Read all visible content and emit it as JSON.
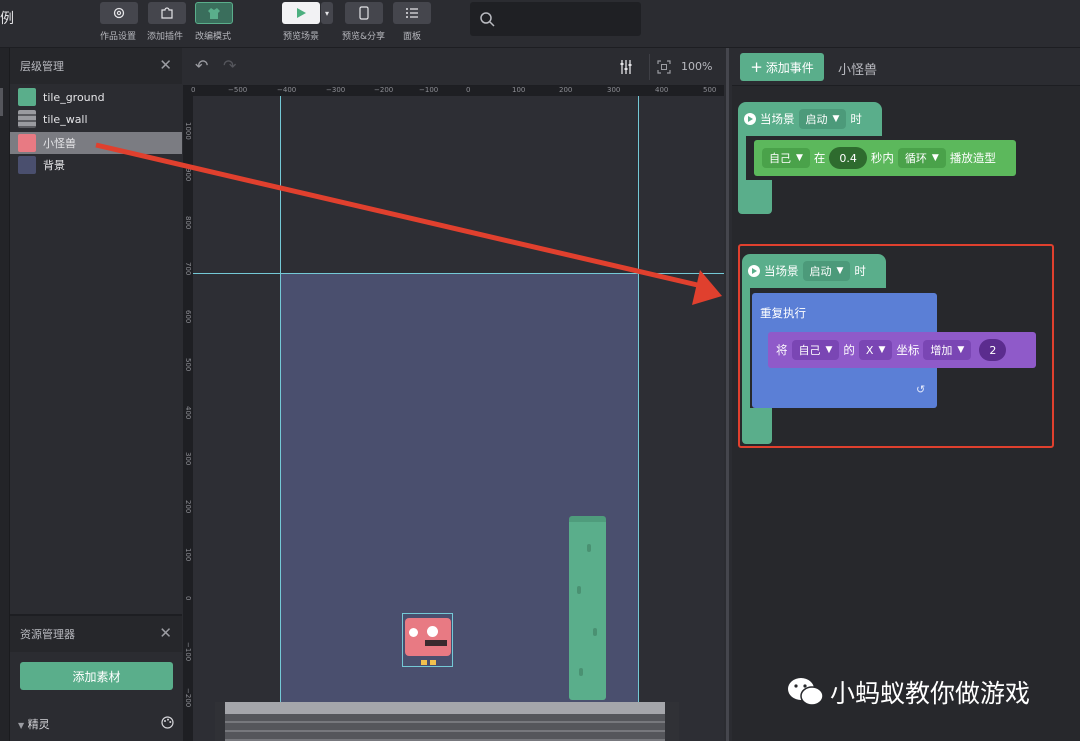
{
  "topbar": {
    "title_fragment": "例",
    "buttons": [
      {
        "label": "作品设置",
        "icon": "gear-icon"
      },
      {
        "label": "添加插件",
        "icon": "puzzle-icon"
      },
      {
        "label": "改编模式",
        "icon": "shirt-icon"
      },
      {
        "label": "预览场景",
        "icon": "play-icon"
      },
      {
        "label": "预览&分享",
        "icon": "phone-icon"
      },
      {
        "label": "面板",
        "icon": "list-icon"
      }
    ],
    "search_placeholder": ""
  },
  "layers": {
    "title": "层级管理",
    "items": [
      {
        "label": "tile_ground",
        "color": "#5aae8b"
      },
      {
        "label": "tile_wall",
        "color": "#8a8b90"
      },
      {
        "label": "小怪兽",
        "color": "#e87a83",
        "selected": true
      },
      {
        "label": "背景",
        "color": "#4a4f6e"
      }
    ]
  },
  "assets": {
    "title": "资源管理器",
    "add_label": "添加素材",
    "section": "精灵"
  },
  "canvas": {
    "zoom": "100%",
    "ruler_x": [
      "0",
      "−500",
      "−400",
      "−300",
      "−200",
      "−100",
      "0",
      "100",
      "200",
      "300",
      "400",
      "500"
    ],
    "ruler_y": [
      "1000",
      "900",
      "800",
      "700",
      "600",
      "500",
      "400",
      "300",
      "200",
      "100",
      "0",
      "−100",
      "−200"
    ]
  },
  "events": {
    "add_event_label": "添加事件",
    "sprite_name": "小怪兽",
    "block1": {
      "hat": "当场景",
      "trigger": "启动",
      "when": "时",
      "self": "自己",
      "at": "在",
      "seconds": "0.4",
      "within": "秒内",
      "loop": "循环",
      "action": "播放造型"
    },
    "block2": {
      "hat": "当场景",
      "trigger": "启动",
      "when": "时",
      "repeat": "重复执行",
      "set": "将",
      "self": "自己",
      "of": "的",
      "axis": "X",
      "coord": "坐标",
      "op": "增加",
      "value": "2"
    }
  },
  "watermark": "小蚂蚁教你做游戏",
  "colors": {
    "accent": "#5aae8b",
    "highlight": "#e0402e",
    "blue_block": "#5b7fd6",
    "purple_block": "#8f5ac9"
  }
}
